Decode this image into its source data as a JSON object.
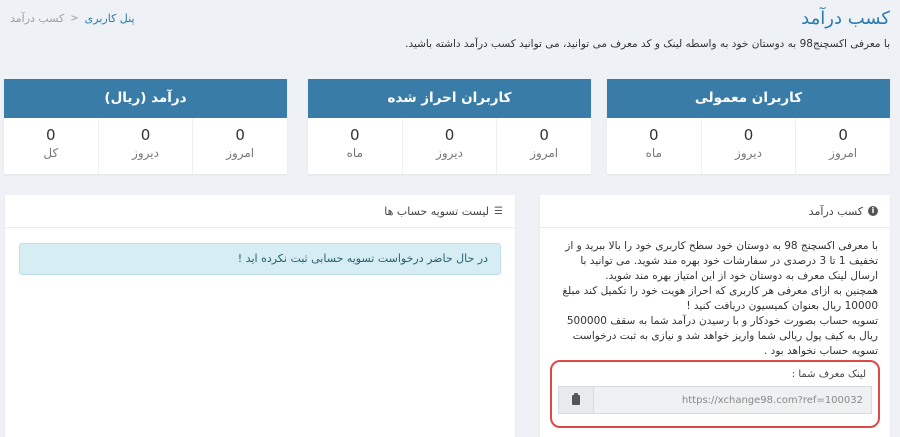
{
  "header": {
    "title": "کسب درآمد",
    "description": "با معرفی اکسچنج98 به دوستان خود به واسطه لینک و کد معرف می توانید، می توانید کسب درآمد داشته باشید."
  },
  "breadcrumb": {
    "home": "پنل کاربری",
    "separator": "<",
    "current": "کسب درآمد"
  },
  "stats": [
    {
      "title": "کاربران معمولی",
      "cells": [
        {
          "label": "امروز",
          "value": "0"
        },
        {
          "label": "دیروز",
          "value": "0"
        },
        {
          "label": "ماه",
          "value": "0"
        }
      ]
    },
    {
      "title": "کاربران احراز شده",
      "cells": [
        {
          "label": "امروز",
          "value": "0"
        },
        {
          "label": "دیروز",
          "value": "0"
        },
        {
          "label": "ماه",
          "value": "0"
        }
      ]
    },
    {
      "title": "درآمد (ریال)",
      "cells": [
        {
          "label": "امروز",
          "value": "0"
        },
        {
          "label": "دیروز",
          "value": "0"
        },
        {
          "label": "کل",
          "value": "0"
        }
      ]
    }
  ],
  "earn_panel": {
    "title": "کسب درآمد",
    "icon": "info-icon",
    "paragraphs": [
      "با معرفی اکسچنج 98 به دوستان خود سطح کاربری خود را بالا ببرید و از تخفیف 1 تا 3 درصدی در سفارشات خود بهره مند شوید. می توانید با ارسال لینک معرف به دوستان خود از این امتیاز بهره مند شوید.",
      "همچنین به ازای معرفی هر کاربری که احراز هویت خود را تکمیل کند مبلغ 10000 ریال بعنوان کمیسیون دریافت کنید !",
      "تسویه حساب بصورت خودکار و با رسیدن درآمد شما به سقف 500000 ریال به کیف پول ریالی شما واریز خواهد شد و نیازی به ثبت درخواست تسویه حساب نخواهد بود ."
    ],
    "ref_label": "لینک معرف شما :",
    "ref_link": "https://xchange98.com?ref=100032",
    "copy_icon": "clipboard-icon"
  },
  "settlement_panel": {
    "title": "لیست تسویه حساب ها",
    "icon": "list-icon",
    "alert": "در حال حاضر درخواست تسویه حسابی ثبت نکرده اید !"
  },
  "colors": {
    "accent": "#3a7ca8",
    "title": "#2a7aae",
    "alert_bg": "#d6eef3",
    "highlight": "#e04747"
  }
}
